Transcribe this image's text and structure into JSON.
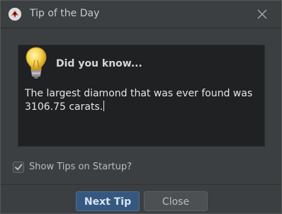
{
  "window": {
    "title": "Tip of the Day"
  },
  "icons": {
    "app": "app-logo-icon",
    "close": "close-icon",
    "lightbulb": "lightbulb-icon",
    "check": "checkmark-icon"
  },
  "tip": {
    "heading": "Did you know...",
    "text": "The largest diamond that was ever found was 3106.75 carats."
  },
  "startup_option": {
    "label": "Show Tips on Startup?",
    "checked": true
  },
  "buttons": {
    "next_tip": "Next Tip",
    "close": "Close"
  },
  "colors": {
    "background": "#3c3f41",
    "content_background": "#1f2122",
    "primary_button": "#365880",
    "secondary_button": "#4c5052"
  }
}
